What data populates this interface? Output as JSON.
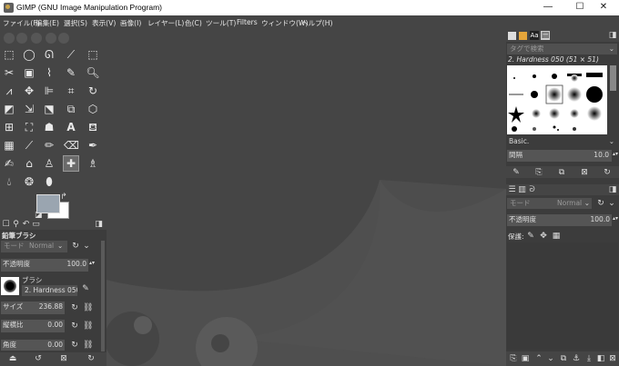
{
  "window": {
    "title": "GIMP (GNU Image Manipulation Program)",
    "min": "—",
    "max": "☐",
    "close": "✕"
  },
  "menu": [
    "ファイル(F)",
    "編集(E)",
    "選択(S)",
    "表示(V)",
    "画像(I)",
    "レイヤー(L)",
    "色(C)",
    "ツール(T)",
    "Filters",
    "ウィンドウ(W)",
    "ヘルプ(H)"
  ],
  "tool_options": {
    "title": "鉛筆ブラシ",
    "mode_label": "モード",
    "mode_value": "Normal",
    "opacity_label": "不透明度",
    "opacity_value": "100.0",
    "brush_label": "ブラシ",
    "brush_name": "2. Hardness 050",
    "size_label": "サイズ",
    "size_value": "236.88",
    "aspect_label": "縦横比",
    "aspect_value": "0.00",
    "angle_label": "角度",
    "angle_value": "0.00"
  },
  "brushes": {
    "filter_placeholder": "タグで検索",
    "selected_title": "2. Hardness 050 (51 × 51)",
    "preset": "Basic.",
    "spacing_label": "間隔",
    "spacing_value": "10.0"
  },
  "layers": {
    "mode_label": "モード",
    "mode_value": "Normal",
    "opacity_label": "不透明度",
    "opacity_value": "100.0",
    "lock_label": "保護:"
  }
}
